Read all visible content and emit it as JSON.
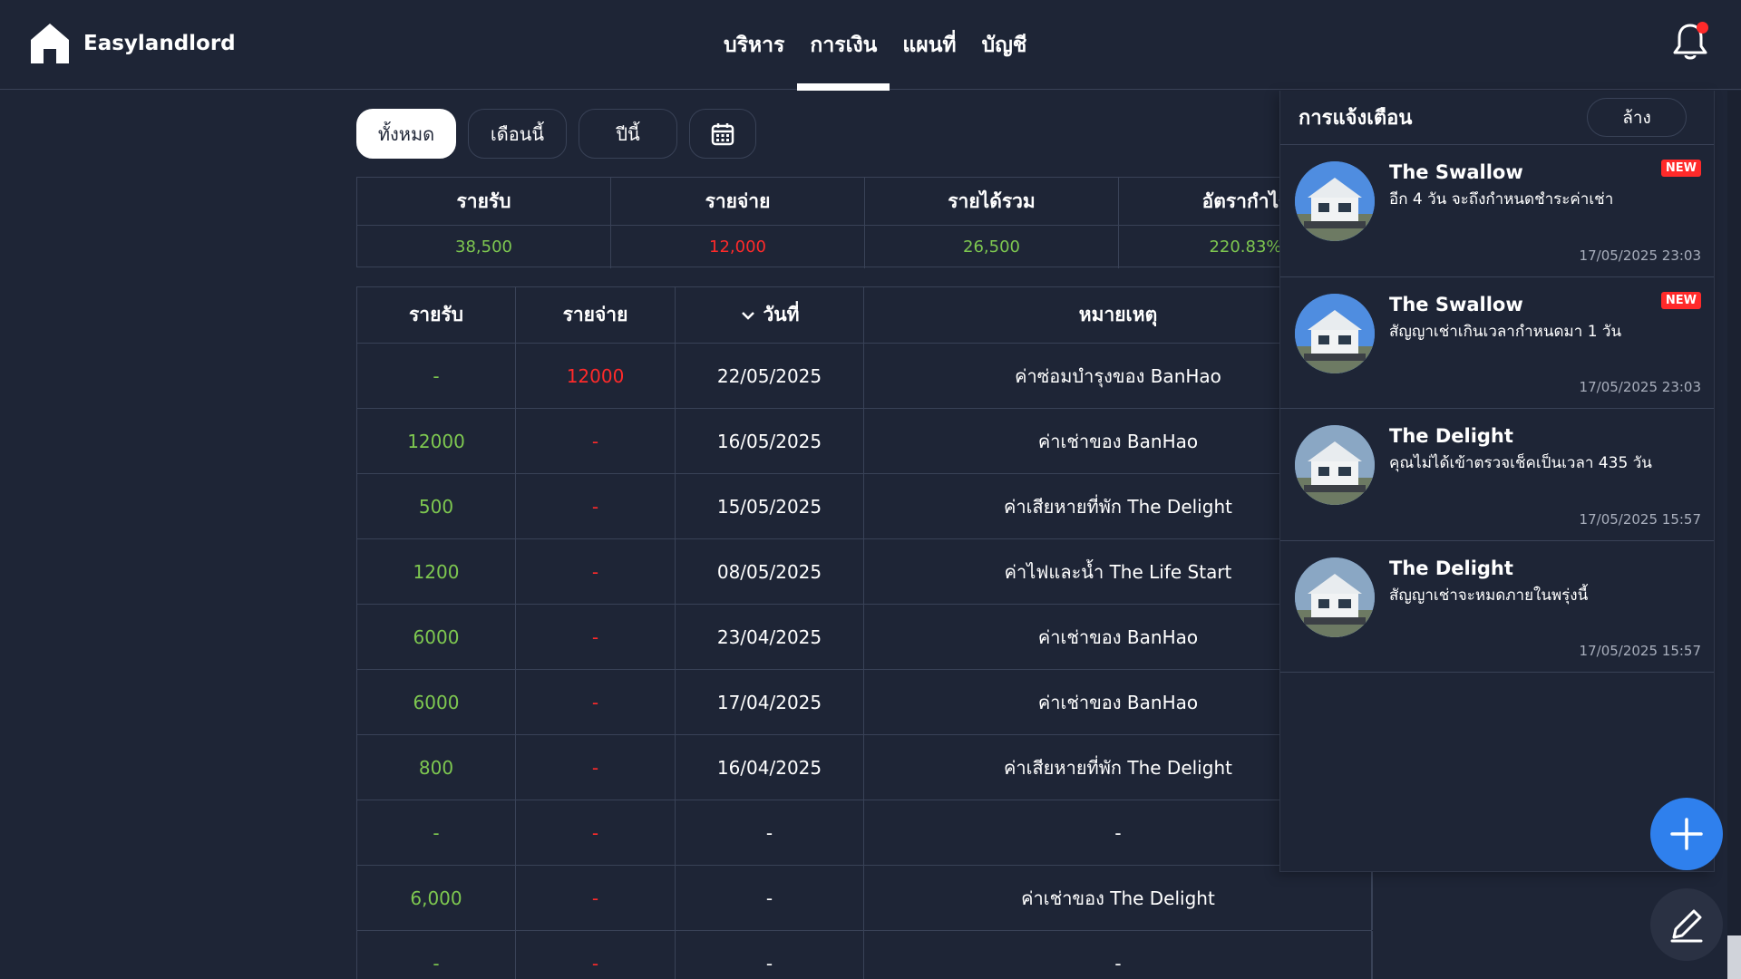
{
  "brand": {
    "name": "Easylandlord",
    "icon": "home-icon"
  },
  "nav": [
    {
      "label": "บริหาร"
    },
    {
      "label": "การเงิน",
      "active": true
    },
    {
      "label": "แผนที่"
    },
    {
      "label": "บัญชี"
    }
  ],
  "filters": {
    "all": "ทั้งหมด",
    "this_month": "เดือนนี้",
    "this_year": "ปีนี้",
    "calendar_icon": "calendar-icon"
  },
  "summary": {
    "headers": [
      "รายรับ",
      "รายจ่าย",
      "รายได้รวม",
      "อัตรากำไร"
    ],
    "values": [
      "38,500",
      "12,000",
      "26,500",
      "220.83%"
    ]
  },
  "ledger": {
    "headers": {
      "income": "รายรับ",
      "expense": "รายจ่าย",
      "date": "วันที่",
      "note": "หมายเหตุ"
    },
    "rows": [
      {
        "income": "-",
        "expense": "12000",
        "date": "22/05/2025",
        "note": "ค่าซ่อมบำรุงของ BanHao"
      },
      {
        "income": "12000",
        "expense": "-",
        "date": "16/05/2025",
        "note": "ค่าเช่าของ BanHao"
      },
      {
        "income": "500",
        "expense": "-",
        "date": "15/05/2025",
        "note": "ค่าเสียหายที่พัก The Delight"
      },
      {
        "income": "1200",
        "expense": "-",
        "date": "08/05/2025",
        "note": "ค่าไฟและน้ำ The Life Start"
      },
      {
        "income": "6000",
        "expense": "-",
        "date": "23/04/2025",
        "note": "ค่าเช่าของ BanHao"
      },
      {
        "income": "6000",
        "expense": "-",
        "date": "17/04/2025",
        "note": "ค่าเช่าของ BanHao"
      },
      {
        "income": "800",
        "expense": "-",
        "date": "16/04/2025",
        "note": "ค่าเสียหายที่พัก The Delight"
      },
      {
        "income": "-",
        "expense": "-",
        "date": "-",
        "note": "-"
      },
      {
        "income": "6,000",
        "expense": "-",
        "date": "-",
        "note": "ค่าเช่าของ The Delight"
      },
      {
        "income": "-",
        "expense": "-",
        "date": "-",
        "note": "-"
      }
    ]
  },
  "notifications": {
    "title": "การแจ้งเตือน",
    "clear_label": "ล้าง",
    "new_label": "NEW",
    "items": [
      {
        "title": "The Swallow",
        "body": "อีก 4 วัน จะถึงกำหนดชำระค่าเช่า",
        "time": "17/05/2025 23:03",
        "is_new": true
      },
      {
        "title": "The Swallow",
        "body": "สัญญาเช่าเกินเวลากำหนดมา 1 วัน",
        "time": "17/05/2025 23:03",
        "is_new": true
      },
      {
        "title": "The Delight",
        "body": "คุณไม่ได้เข้าตรวจเช็คเป็นเวลา 435 วัน",
        "time": "17/05/2025 15:57",
        "is_new": false
      },
      {
        "title": "The Delight",
        "body": "สัญญาเช่าจะหมดภายในพรุ่งนี้",
        "time": "17/05/2025 15:57",
        "is_new": false
      }
    ]
  },
  "colors": {
    "background": "#1e2536",
    "income": "#7ec850",
    "expense": "#ff2a2a",
    "accent": "#2f80ed"
  },
  "icons": {
    "bell": "bell-icon",
    "add": "plus-icon",
    "edit": "pencil-icon",
    "sort": "chevron-down-icon"
  }
}
